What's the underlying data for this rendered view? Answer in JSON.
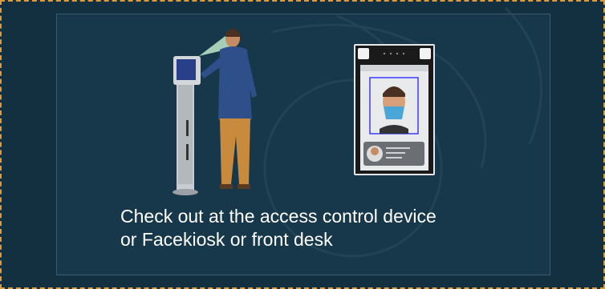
{
  "caption": {
    "line1": "Check out at the access control device",
    "line2": "or Facekiosk or front desk"
  },
  "colors": {
    "frame_border": "#e09a3a",
    "background": "#12303f",
    "panel": "#17384a",
    "text": "#ffffff",
    "face_frame": "#3a3aff"
  },
  "illustrations": {
    "left": "person-at-kiosk-illustration",
    "right": "face-recognition-device-illustration"
  }
}
